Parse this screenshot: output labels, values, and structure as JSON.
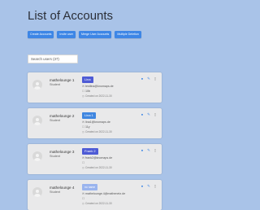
{
  "page": {
    "title": "List of Accounts"
  },
  "toolbar": {
    "buttons": [
      {
        "label": "Create Accounts"
      },
      {
        "label": "Invite user"
      },
      {
        "label": "Merge User Accounts"
      },
      {
        "label": "Multiple Deletion"
      }
    ]
  },
  "search": {
    "placeholder": "Search users (37)"
  },
  "accounts": [
    {
      "username": "mathelounge 1",
      "role": "Student",
      "badge": "Lina",
      "email": "testlina@knomaps.de",
      "field": "10b",
      "created": "Created on 2022-11-30"
    },
    {
      "username": "mathelounge 2",
      "role": "Student",
      "badge": "Lina 1",
      "email": "lina1@knomaps.de",
      "field": "11y",
      "created": "Created on 2022-11-30"
    },
    {
      "username": "mathelounge 3",
      "role": "Student",
      "badge": "Frank 2",
      "email": "frank2@knomaps.de",
      "field": "",
      "created": "Created on 2022-11-30"
    },
    {
      "username": "mathelounge 4",
      "role": "Student",
      "badge": "no name",
      "email": "mathelounge.4@mathenetz.de",
      "field": "",
      "created": "Created on 2022-11-30"
    }
  ],
  "icons": {
    "view": "eye-icon",
    "edit": "pencil-icon",
    "delete": "trash-icon",
    "email": "envelope-icon",
    "field": "checkbox-icon",
    "created": "clock-icon"
  },
  "colors": {
    "background": "#a9c3e8",
    "button": "#3d86e6",
    "badge": "#4e5bd5",
    "card": "#e9e9ea"
  }
}
